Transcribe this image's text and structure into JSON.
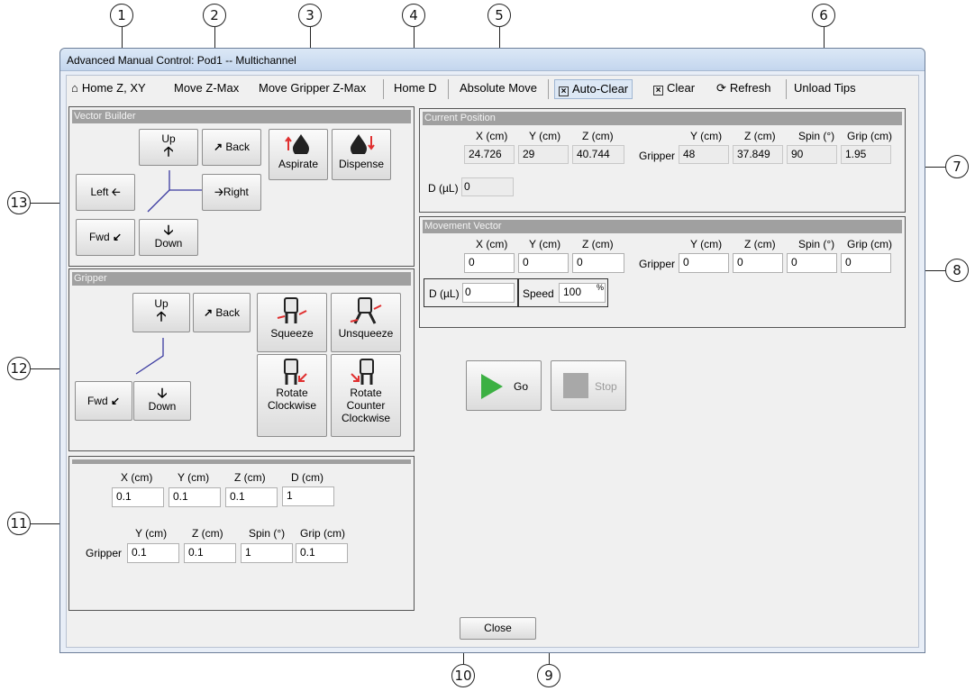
{
  "window": {
    "title": "Advanced Manual Control: Pod1 -- Multichannel"
  },
  "toolbar": {
    "home_zxy": "Home Z, XY",
    "move_zmax": "Move Z-Max",
    "move_gripper_zmax": "Move Gripper Z-Max",
    "home_d": "Home D",
    "absolute_move": "Absolute Move",
    "auto_clear": "Auto-Clear",
    "clear": "Clear",
    "refresh": "Refresh",
    "unload_tips": "Unload Tips"
  },
  "callouts": [
    "1",
    "2",
    "3",
    "4",
    "5",
    "6",
    "7",
    "8",
    "9",
    "10",
    "11",
    "12",
    "13"
  ],
  "vector_builder": {
    "title": "Vector Builder",
    "up": "Up",
    "back": "Back",
    "left": "Left",
    "right": "Right",
    "fwd": "Fwd",
    "down": "Down",
    "aspirate": "Aspirate",
    "dispense": "Dispense"
  },
  "gripper": {
    "title": "Gripper",
    "up": "Up",
    "back": "Back",
    "fwd": "Fwd",
    "down": "Down",
    "squeeze": "Squeeze",
    "unsqueeze": "Unsqueeze",
    "rotate_cw_1": "Rotate",
    "rotate_cw_2": "Clockwise",
    "rotate_ccw_1": "Rotate",
    "rotate_ccw_2": "Counter",
    "rotate_ccw_3": "Clockwise"
  },
  "step_sizes": {
    "x_label": "X (cm)",
    "y_label": "Y (cm)",
    "z_label": "Z (cm)",
    "d_label": "D (cm)",
    "x": "0.1",
    "y": "0.1",
    "z": "0.1",
    "d": "1",
    "gripper_label": "Gripper",
    "gy_label": "Y (cm)",
    "gz_label": "Z (cm)",
    "gspin_label": "Spin (°)",
    "ggrip_label": "Grip (cm)",
    "gy": "0.1",
    "gz": "0.1",
    "gspin": "1",
    "ggrip": "0.1"
  },
  "current_position": {
    "title": "Current Position",
    "x_label": "X (cm)",
    "y_label": "Y (cm)",
    "z_label": "Z (cm)",
    "x": "24.726",
    "y": "29",
    "z": "40.744",
    "gripper_label": "Gripper",
    "gy_label": "Y (cm)",
    "gz_label": "Z (cm)",
    "gspin_label": "Spin (°)",
    "ggrip_label": "Grip (cm)",
    "gy": "48",
    "gz": "37.849",
    "gspin": "90",
    "ggrip": "1.95",
    "d_label": "D (µL)",
    "d": "0"
  },
  "movement_vector": {
    "title": "Movement Vector",
    "x_label": "X (cm)",
    "y_label": "Y (cm)",
    "z_label": "Z (cm)",
    "x": "0",
    "y": "0",
    "z": "0",
    "gripper_label": "Gripper",
    "gy_label": "Y (cm)",
    "gz_label": "Z (cm)",
    "gspin_label": "Spin (°)",
    "ggrip_label": "Grip (cm)",
    "gy": "0",
    "gz": "0",
    "gspin": "0",
    "ggrip": "0",
    "d_label": "D (µL)",
    "d": "0",
    "speed_label": "Speed",
    "speed": "100",
    "speed_unit": "%"
  },
  "actions": {
    "go": "Go",
    "stop": "Stop",
    "close": "Close"
  },
  "colors": {
    "go_green": "#3cb043",
    "stop_gray": "#a8a8a8",
    "panel_header": "#a0a0a0",
    "axis_line": "#3a3aa0",
    "arrow_red": "#e03030"
  }
}
